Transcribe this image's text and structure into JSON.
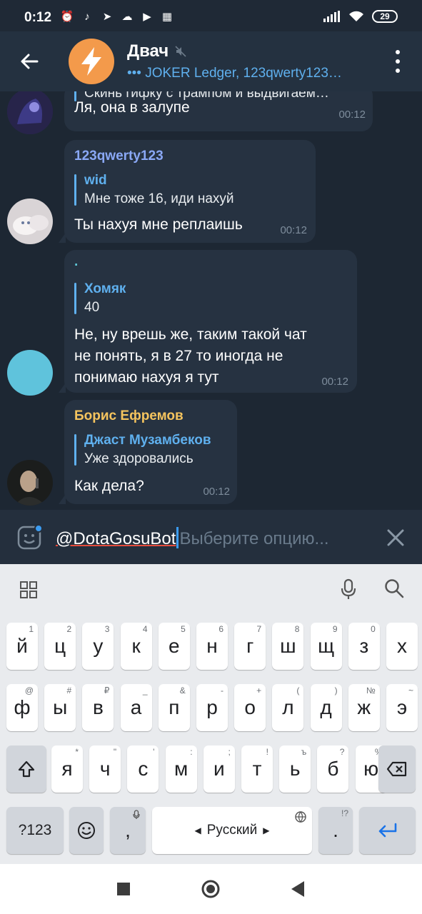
{
  "status": {
    "time": "0:12",
    "battery": "29"
  },
  "header": {
    "title": "Двач",
    "subtitle": "••• JOKER Ledger, 123qwerty123…"
  },
  "messages": [
    {
      "reply_text": "Скинь гифку с трампом и выдвигаем…",
      "text": "Ля, она в залупе",
      "time": "00:12"
    },
    {
      "sender": "123qwerty123",
      "sender_color": "#8aa8f5",
      "reply_name": "wid",
      "reply_text": "Мне тоже 16, иди нахуй",
      "text": "Ты нахуя мне реплаишь",
      "time": "00:12"
    },
    {
      "sender": ".",
      "sender_color": "#5fc7d6",
      "reply_name": "Хомяк",
      "reply_text": "40",
      "text_lines": [
        "Не, ну врешь же, таким такой чат",
        "не понять, я в 27 то иногда не",
        "понимаю нахуя я тут"
      ],
      "time": "00:12"
    },
    {
      "sender": "Борис Ефремов",
      "sender_color": "#f5c45e",
      "reply_name": "Джаст Музамбеков",
      "reply_text": "Уже здоровались",
      "text": "Как дела?",
      "time": "00:12"
    }
  ],
  "input": {
    "mention": "@DotaGosuBot",
    "placeholder": "Выберите опцию..."
  },
  "keyboard": {
    "row1": [
      {
        "k": "й",
        "h": "1"
      },
      {
        "k": "ц",
        "h": "2"
      },
      {
        "k": "у",
        "h": "3"
      },
      {
        "k": "к",
        "h": "4"
      },
      {
        "k": "е",
        "h": "5"
      },
      {
        "k": "н",
        "h": "6"
      },
      {
        "k": "г",
        "h": "7"
      },
      {
        "k": "ш",
        "h": "8"
      },
      {
        "k": "щ",
        "h": "9"
      },
      {
        "k": "з",
        "h": "0"
      },
      {
        "k": "х",
        "h": ""
      }
    ],
    "row2": [
      {
        "k": "ф",
        "h": "@"
      },
      {
        "k": "ы",
        "h": "#"
      },
      {
        "k": "в",
        "h": "₽"
      },
      {
        "k": "а",
        "h": "_"
      },
      {
        "k": "п",
        "h": "&"
      },
      {
        "k": "р",
        "h": "-"
      },
      {
        "k": "о",
        "h": "+"
      },
      {
        "k": "л",
        "h": "("
      },
      {
        "k": "д",
        "h": ")"
      },
      {
        "k": "ж",
        "h": "№"
      },
      {
        "k": "э",
        "h": "~"
      }
    ],
    "row3": [
      {
        "k": "я",
        "h": "*"
      },
      {
        "k": "ч",
        "h": "\""
      },
      {
        "k": "с",
        "h": "'"
      },
      {
        "k": "м",
        "h": ":"
      },
      {
        "k": "и",
        "h": ";"
      },
      {
        "k": "т",
        "h": "!"
      },
      {
        "k": "ь",
        "h": "ъ"
      },
      {
        "k": "б",
        "h": "?"
      },
      {
        "k": "ю",
        "h": "%"
      }
    ],
    "symbols": "?123",
    "comma": ",",
    "space": "Русский",
    "period": "."
  }
}
